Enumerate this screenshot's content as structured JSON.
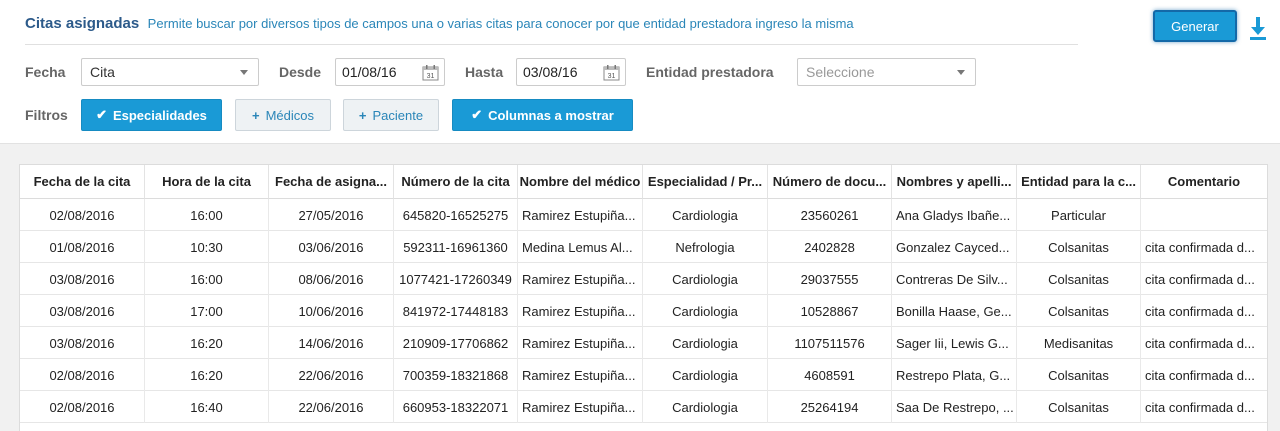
{
  "header": {
    "title": "Citas asignadas",
    "subtitle": "Permite buscar por diversos tipos de campos una o varias citas para conocer por que entidad prestadora ingreso la misma",
    "generate_label": "Generar"
  },
  "filters": {
    "fecha_label": "Fecha",
    "fecha_value": "Cita",
    "desde_label": "Desde",
    "desde_value": "01/08/16",
    "hasta_label": "Hasta",
    "hasta_value": "03/08/16",
    "entidad_label": "Entidad prestadora",
    "entidad_placeholder": "Seleccione",
    "filtros_label": "Filtros",
    "chips": [
      {
        "label": "Especialidades",
        "active": true,
        "icon": "check-icon"
      },
      {
        "label": "Médicos",
        "active": false,
        "icon": "plus-icon"
      },
      {
        "label": "Paciente",
        "active": false,
        "icon": "plus-icon"
      },
      {
        "label": "Columnas a mostrar",
        "active": true,
        "icon": "check-icon"
      }
    ]
  },
  "table": {
    "columns": [
      "Fecha de la cita",
      "Hora de la cita",
      "Fecha de asigna...",
      "Número de la cita",
      "Nombre del médico",
      "Especialidad / Pr...",
      "Número de docu...",
      "Nombres y apelli...",
      "Entidad para la c...",
      "Comentario"
    ],
    "rows": [
      [
        "02/08/2016",
        "16:00",
        "27/05/2016",
        "645820-16525275",
        "Ramirez Estupiña...",
        "Cardiologia",
        "23560261",
        "Ana Gladys Ibañe...",
        "Particular",
        ""
      ],
      [
        "01/08/2016",
        "10:30",
        "03/06/2016",
        "592311-16961360",
        "Medina Lemus Al...",
        "Nefrologia",
        "2402828",
        "Gonzalez Cayced...",
        "Colsanitas",
        "cita confirmada d..."
      ],
      [
        "03/08/2016",
        "16:00",
        "08/06/2016",
        "1077421-17260349",
        "Ramirez Estupiña...",
        "Cardiologia",
        "29037555",
        "Contreras De Silv...",
        "Colsanitas",
        "cita confirmada d..."
      ],
      [
        "03/08/2016",
        "17:00",
        "10/06/2016",
        "841972-17448183",
        "Ramirez Estupiña...",
        "Cardiologia",
        "10528867",
        "Bonilla Haase, Ge...",
        "Colsanitas",
        "cita confirmada d..."
      ],
      [
        "03/08/2016",
        "16:20",
        "14/06/2016",
        "210909-17706862",
        "Ramirez Estupiña...",
        "Cardiologia",
        "1107511576",
        "Sager Iii, Lewis G...",
        "Medisanitas",
        "cita confirmada d..."
      ],
      [
        "02/08/2016",
        "16:20",
        "22/06/2016",
        "700359-18321868",
        "Ramirez Estupiña...",
        "Cardiologia",
        "4608591",
        "Restrepo Plata, G...",
        "Colsanitas",
        "cita confirmada d..."
      ],
      [
        "02/08/2016",
        "16:40",
        "22/06/2016",
        "660953-18322071",
        "Ramirez Estupiña...",
        "Cardiologia",
        "25264194",
        "Saa De Restrepo, ...",
        "Colsanitas",
        "cita confirmada d..."
      ]
    ]
  },
  "colors": {
    "accent": "#1a9ad6",
    "title": "#2c5a8a",
    "link": "#2a86b8"
  }
}
